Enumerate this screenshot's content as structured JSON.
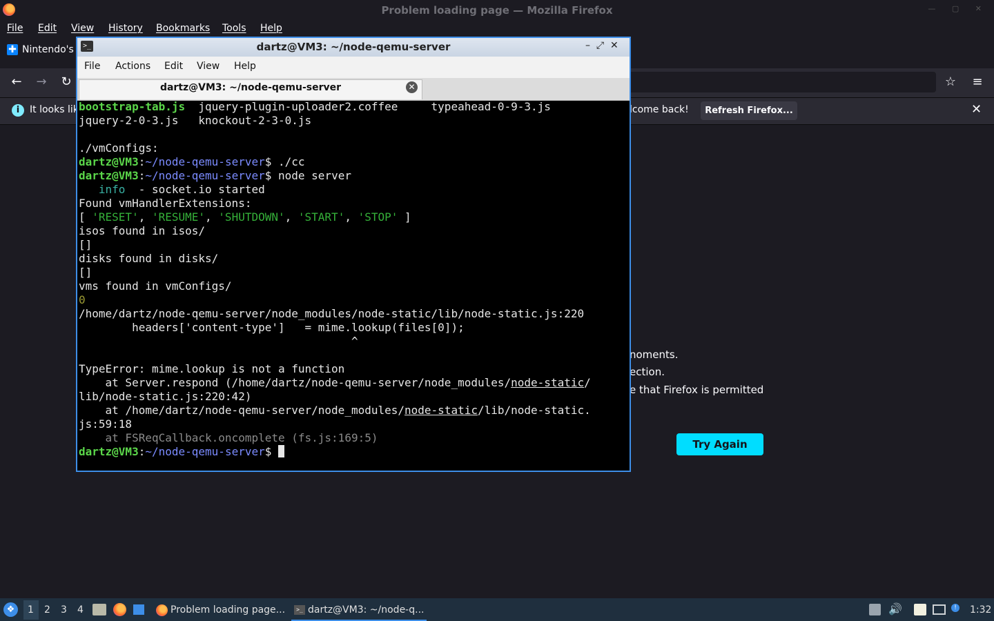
{
  "firefox": {
    "window_title": "Problem loading page — Mozilla Firefox",
    "menu": [
      "File",
      "Edit",
      "View",
      "History",
      "Bookmarks",
      "Tools",
      "Help"
    ],
    "tab_title": "Nintendo's e",
    "notification": {
      "text": "It looks lik",
      "welcome": "lcome back!",
      "refresh_button": "Refresh Firefox..."
    },
    "error_lines": [
      "noments.",
      "ection.",
      "e that Firefox is permitted"
    ],
    "try_again": "Try Again"
  },
  "terminal": {
    "window_title": "dartz@VM3: ~/node-qemu-server",
    "menu": [
      "File",
      "Actions",
      "Edit",
      "View",
      "Help"
    ],
    "tab_title": "dartz@VM3: ~/node-qemu-server",
    "prompt_user": "dartz@VM3",
    "prompt_path": "~/node-qemu-server",
    "prompt_sym": "$",
    "lines": {
      "files1_a": "bootstrap-tab.js",
      "files1_b": "  jquery-plugin-uploader2.coffee     typeahead-0-9-3.js",
      "files2": "jquery-2-0-3.js   knockout-2-3-0.js",
      "vmconfigs": "./vmConfigs:",
      "cmd1": " ./cc",
      "cmd2": " node server",
      "info_pad": "   ",
      "info_word": "info",
      "info_rest": "  - socket.io started",
      "found_ext": "Found vmHandlerExtensions:",
      "arr_open": "[ ",
      "arr_items": [
        "'RESET'",
        "'RESUME'",
        "'SHUTDOWN'",
        "'START'",
        "'STOP'"
      ],
      "arr_sep": ", ",
      "arr_close": " ]",
      "isos": "isos found in isos/",
      "empty1": "[]",
      "disks": "disks found in disks/",
      "empty2": "[]",
      "vms": "vms found in vmConfigs/",
      "zero": "0",
      "path_line": "/home/dartz/node-qemu-server/node_modules/node-static/lib/node-static.js:220",
      "code_line": "        headers['content-type']   = mime.lookup(files[0]);",
      "caret_line": "                                         ^",
      "type_error": "TypeError: mime.lookup is not a function",
      "at1_a": "    at Server.respond (/home/dartz/node-qemu-server/node_modules/",
      "at1_u": "node-static",
      "at1_b": "/",
      "at1_c": "lib/node-static.js:220:42)",
      "at2_a": "    at /home/dartz/node-qemu-server/node_modules/",
      "at2_u": "node-static",
      "at2_b": "/lib/node-static.",
      "at2_c": "js:59:18",
      "at3": "    at FSReqCallback.oncomplete (fs.js:169:5)"
    }
  },
  "taskbar": {
    "workspaces": [
      "1",
      "2",
      "3",
      "4"
    ],
    "tasks": [
      "Problem loading page...",
      "dartz@VM3: ~/node-q..."
    ],
    "clock": "1:32"
  },
  "colors": {
    "prompt_user": "#5bd64a",
    "prompt_path": "#7b8bff",
    "terminal_border": "#3d8ee8",
    "try_again_bg": "#00ddff"
  }
}
